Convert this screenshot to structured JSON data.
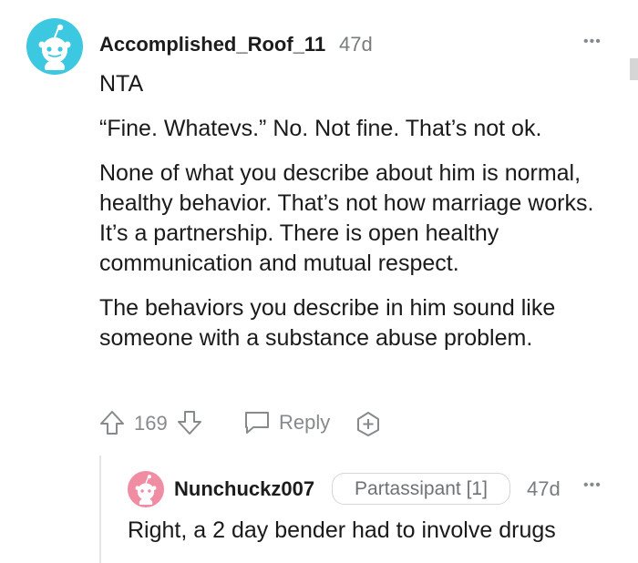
{
  "comment": {
    "username": "Accomplished_Roof_11",
    "age": "47d",
    "more_label": "•••",
    "paragraphs": [
      "NTA",
      "“Fine. Whatevs.” No. Not fine. That’s not ok.",
      "None of what you describe about him is normal, healthy behavior. That’s not how marriage works. It’s a partnership. There is open healthy communication and mutual respect.",
      "The behaviors you describe in him sound like someone with a substance abuse problem."
    ],
    "votes": "169",
    "reply_label": "Reply",
    "avatar_color": "#3cc8e0"
  },
  "reply": {
    "username": "Nunchuckz007",
    "flair": "Partassipant [1]",
    "age": "47d",
    "more_label": "•••",
    "text": "Right, a 2 day bender had to involve drugs",
    "avatar_color": "#f08da3"
  }
}
